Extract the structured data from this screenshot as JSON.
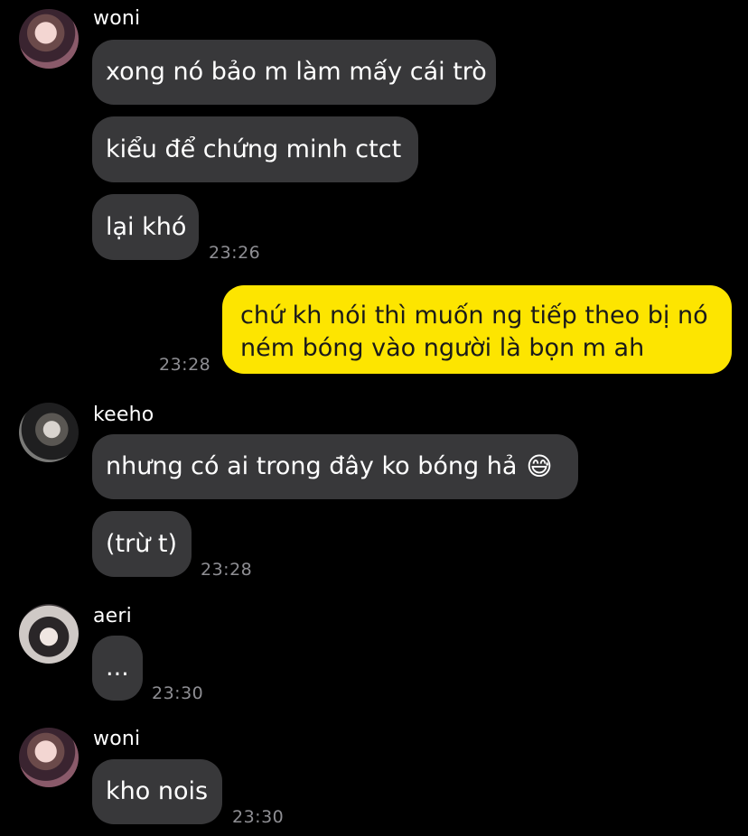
{
  "messages": [
    {
      "sender": "woni",
      "text": "xong nó bảo m làm mấy cái trò"
    },
    {
      "sender": "woni",
      "text": "kiểu để chứng minh ctct"
    },
    {
      "sender": "woni",
      "text": "lại khó",
      "time": "23:26"
    },
    {
      "sender": "me",
      "text": "chứ kh nói thì muốn ng tiếp theo bị nó ném bóng vào người là bọn m ah",
      "time": "23:28"
    },
    {
      "sender": "keeho",
      "text": "nhưng có ai trong đây ko bóng hả",
      "emoji": "😅"
    },
    {
      "sender": "keeho",
      "text": "(trừ t)",
      "time": "23:28"
    },
    {
      "sender": "aeri",
      "text": "...",
      "time": "23:30"
    },
    {
      "sender": "woni",
      "text": "kho nois",
      "time": "23:30"
    }
  ],
  "colors": {
    "background": "#000000",
    "incoming_bubble": "#38383a",
    "outgoing_bubble": "#fde500",
    "timestamp": "#8e8e93"
  }
}
